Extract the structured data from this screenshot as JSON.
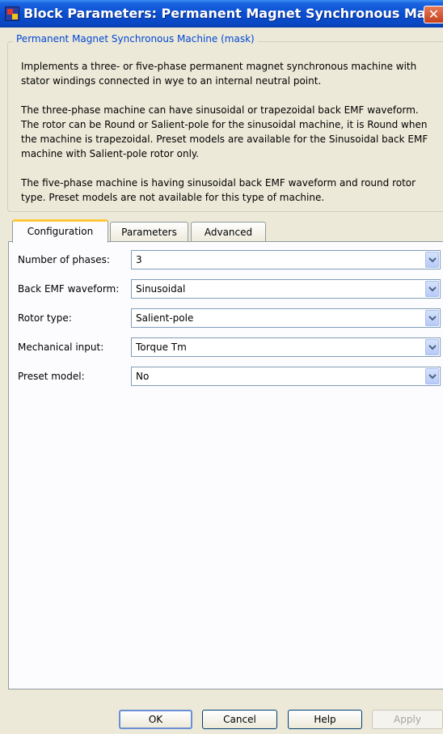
{
  "window": {
    "title": "Block Parameters: Permanent Magnet Synchronous Machine",
    "close_glyph": "✕",
    "icon": "simulink-block-icon"
  },
  "mask": {
    "legend": "Permanent Magnet Synchronous Machine (mask)",
    "paragraphs": [
      [
        "Implements a three- or five-phase permanent magnet synchronous machine with",
        "stator windings connected in wye to an internal neutral point."
      ],
      [
        "The three-phase machine can have sinusoidal or trapezoidal back EMF waveform.",
        "The rotor can be Round or Salient-pole for the sinusoidal machine, it is Round when",
        "the machine is trapezoidal. Preset models are available for the Sinusoidal back EMF",
        "machine with Salient-pole rotor only."
      ],
      [
        "The five-phase machine is having sinusoidal back EMF waveform and round rotor",
        "type. Preset models are not available for this type of machine."
      ]
    ]
  },
  "tabs": [
    {
      "label": "Configuration",
      "active": true
    },
    {
      "label": "Parameters",
      "active": false
    },
    {
      "label": "Advanced",
      "active": false
    }
  ],
  "fields": [
    {
      "label": "Number of phases:",
      "value": "3"
    },
    {
      "label": "Back EMF waveform:",
      "value": "Sinusoidal"
    },
    {
      "label": "Rotor type:",
      "value": "Salient-pole"
    },
    {
      "label": "Mechanical input:",
      "value": "Torque Tm"
    },
    {
      "label": "Preset model:",
      "value": "No"
    }
  ],
  "buttons": {
    "ok": "OK",
    "cancel": "Cancel",
    "help": "Help",
    "apply": "Apply"
  },
  "colors": {
    "title_bar": "#0a4fd0",
    "close_button": "#d9532a",
    "active_tab_highlight": "#ffc83c",
    "legend_text": "#0046d5",
    "dialog_face": "#ece9d8"
  }
}
